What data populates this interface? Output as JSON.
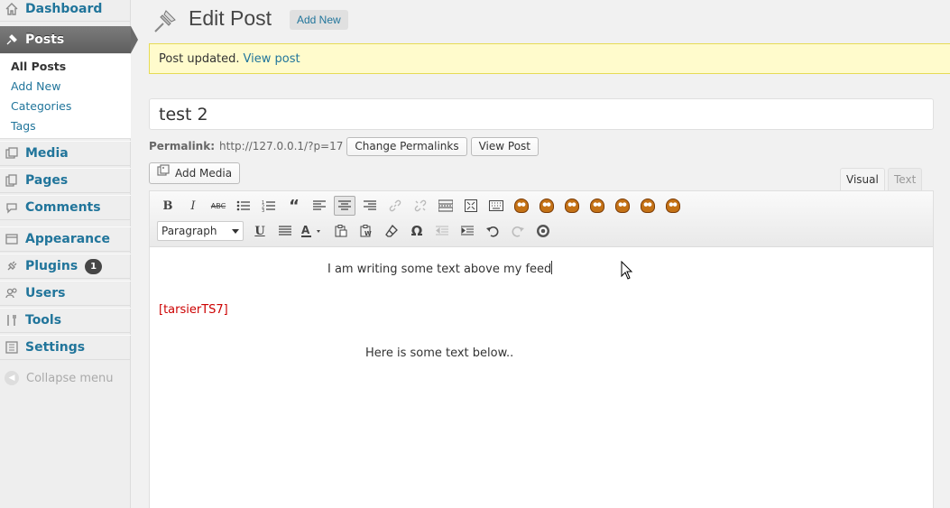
{
  "sidebar": {
    "items": [
      {
        "label": "Dashboard"
      },
      {
        "label": "Posts"
      },
      {
        "label": "Media"
      },
      {
        "label": "Pages"
      },
      {
        "label": "Comments"
      },
      {
        "label": "Appearance"
      },
      {
        "label": "Plugins",
        "badge": "1"
      },
      {
        "label": "Users"
      },
      {
        "label": "Tools"
      },
      {
        "label": "Settings"
      }
    ],
    "submenu": [
      "All Posts",
      "Add New",
      "Categories",
      "Tags"
    ],
    "collapse_label": "Collapse menu"
  },
  "header": {
    "title": "Edit Post",
    "add_new": "Add New"
  },
  "notice": {
    "text": "Post updated.",
    "link": "View post"
  },
  "post": {
    "title_value": "test 2"
  },
  "permalink": {
    "label": "Permalink:",
    "url": "http://127.0.0.1/?p=17",
    "change_button": "Change Permalinks",
    "view_button": "View Post"
  },
  "media": {
    "add_media_label": "Add Media"
  },
  "editor": {
    "tabs": {
      "visual": "Visual",
      "text": "Text"
    },
    "format_select": "Paragraph",
    "content": {
      "line1": "I am writing some text above my feed",
      "shortcode": "[tarsierTS7]",
      "line2": "Here is some text below.."
    }
  },
  "colors": {
    "link": "#21759b",
    "notice_bg": "#fffbcc",
    "shortcode": "#cc0000",
    "menu_current": "#6a6a6a"
  }
}
